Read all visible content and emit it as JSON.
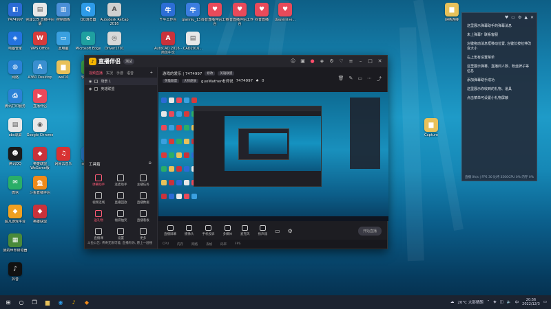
{
  "desktop": {
    "icons": [
      {
        "label": "7474997",
        "icon": "app-icon",
        "color": "#2b6bd6"
      },
      {
        "label": "完成公司 直播中间版",
        "icon": "document-icon",
        "color": "#e8e8e8"
      },
      {
        "label": "控制面板",
        "icon": "control-panel-icon",
        "color": "#4a8fd8"
      },
      {
        "label": "QQ浏览器",
        "icon": "qq-browser-icon",
        "color": "#2d9be8"
      },
      {
        "label": "Autodesk ReCap 2016",
        "icon": "autodesk-icon",
        "color": "#d0d0d0"
      },
      {
        "label": "千牛工作台",
        "icon": "qianniu-icon",
        "color": "#2c6ed6"
      },
      {
        "label": "qianniu_13...",
        "icon": "qianniu-icon",
        "color": "#3b7de0"
      },
      {
        "label": "抖音直播伴侣工作台",
        "icon": "douyin-heart-icon",
        "color": "#e94a5a"
      },
      {
        "label": "抖音直播伴侣工作台",
        "icon": "douyin-heart-icon",
        "color": "#e94a5a"
      },
      {
        "label": "抖音直播",
        "icon": "douyin-heart-icon",
        "color": "#e94a5a"
      },
      {
        "label": "douyinlive...",
        "icon": "douyin-heart-icon",
        "color": "#e94a5a"
      },
      {
        "label": "网络连接",
        "icon": "folder-icon",
        "color": "#e8c15a"
      },
      {
        "label": "电脑管家",
        "icon": "shield-icon",
        "color": "#2473e0"
      },
      {
        "label": "WPS Office",
        "icon": "wps-icon",
        "color": "#d63b3b"
      },
      {
        "label": "此电脑",
        "icon": "computer-icon",
        "color": "#3aa0e0"
      },
      {
        "label": "Microsoft Edge",
        "icon": "edge-icon",
        "color": "#1fa0a0"
      },
      {
        "label": "Driver1701",
        "icon": "driver-icon",
        "color": "#d8d8d8"
      },
      {
        "label": "AutoCAD 2016 - 简体中文",
        "icon": "autocad-icon",
        "color": "#c9323b"
      },
      {
        "label": "CAD2016...",
        "icon": "document-icon",
        "color": "#e8e8e8"
      },
      {
        "label": "网络",
        "icon": "network-icon",
        "color": "#2b82d6"
      },
      {
        "label": "A360 Desktop",
        "icon": "a360-icon",
        "color": "#3a8fd0"
      },
      {
        "label": "wxl10",
        "icon": "folder-icon",
        "color": "#e8c15a"
      },
      {
        "label": "软件管家",
        "icon": "software-icon",
        "color": "#40b050"
      },
      {
        "label": "腾讯打印服务",
        "icon": "printer-icon",
        "color": "#2b82d6"
      },
      {
        "label": "直播伴侣",
        "icon": "live-icon",
        "color": "#e94a5a"
      },
      {
        "label": "obs录屏",
        "icon": "document-icon",
        "color": "#e8e8e8"
      },
      {
        "label": "Google Chrome",
        "icon": "chrome-icon",
        "color": "#e8e8e8"
      },
      {
        "label": "Capture",
        "icon": "folder-icon",
        "color": "#e8c15a"
      },
      {
        "label": "腾讯QQ",
        "icon": "qq-icon",
        "color": "#1b1b1b"
      },
      {
        "label": "英雄联盟 WeGame版",
        "icon": "game-icon",
        "color": "#c9323b"
      },
      {
        "label": "网易云音乐",
        "icon": "music-icon",
        "color": "#d83232"
      },
      {
        "label": "百度网盘",
        "icon": "cloud-icon",
        "color": "#2b82d6"
      },
      {
        "label": "微信",
        "icon": "wechat-icon",
        "color": "#2aae67"
      },
      {
        "label": "斗鱼直播伴侣",
        "icon": "douyu-icon",
        "color": "#f08a1a"
      },
      {
        "label": "超凡游戏平台",
        "icon": "game-icon",
        "color": "#f0a020"
      },
      {
        "label": "英雄联盟",
        "icon": "game-icon",
        "color": "#c9323b"
      },
      {
        "label": "我的世界启动器",
        "icon": "minecraft-icon",
        "color": "#4a8a3a"
      },
      {
        "label": "抖音",
        "icon": "tiktok-icon",
        "color": "#111111"
      }
    ]
  },
  "app": {
    "name": "直播伴侣",
    "badge": "测试",
    "tabs": [
      "视频直播",
      "实况",
      "手游",
      "语音"
    ],
    "scenes": [
      "场景 1",
      "英雄联盟"
    ],
    "tools_title": "工具箱",
    "tools": [
      {
        "label": "弹幕助手",
        "highlight": true
      },
      {
        "label": "连麦助手",
        "highlight": false
      },
      {
        "label": "主播任务",
        "highlight": false
      },
      {
        "label": "视频连线",
        "highlight": false
      },
      {
        "label": "直播回放",
        "highlight": false
      },
      {
        "label": "直播数据",
        "highlight": false
      },
      {
        "label": "送礼物",
        "highlight": true
      },
      {
        "label": "福袋抽奖",
        "highlight": false
      },
      {
        "label": "直播看板",
        "highlight": false
      },
      {
        "label": "直播课",
        "highlight": false
      },
      {
        "label": "设置",
        "highlight": false
      },
      {
        "label": "更多",
        "highlight": false
      }
    ],
    "notice": "斗鱼公告: 传奇无限可能, 直播有你, 愿上一层楼",
    "room": {
      "title": "游戏的爱乐 | 7474997",
      "edit_label": "修改",
      "category": "英雄联盟",
      "tags": [
        "英雄联盟",
        "大师皮肤"
      ],
      "user": "guoWather老师说",
      "id": "7474997",
      "viewers": "0"
    },
    "bottom_tools": [
      "直播屏幕",
      "摄像头",
      "手机投屏",
      "多媒体",
      "麦克风",
      "扬声器"
    ],
    "start_label": "开始直播",
    "status": [
      "CPU",
      "内存",
      "网络",
      "丢帧",
      "码率",
      "FPS"
    ]
  },
  "side_panel": {
    "messages": [
      "这里展示弹幕助手的弹幕消息",
      "未上弹幕？联系客服",
      "左键拖动消息框移动位置, 左键长按拉伸改变大小",
      "右上角有设置菜单",
      "这里展示弹幕、直播间人数、粉丝牌子等信息",
      "添加弹幕助手成功",
      "这里展示你收到的礼物、道具",
      "点击菜单可设置小礼物屏蔽"
    ],
    "footer_left": "直播 0h/s | FPS 30 比特 3500",
    "footer_right": "CPU 0% 内存 0%"
  },
  "taskbar": {
    "weather": "20°C 大部晴朗",
    "time": "20:56",
    "date": "2022/12/3"
  }
}
